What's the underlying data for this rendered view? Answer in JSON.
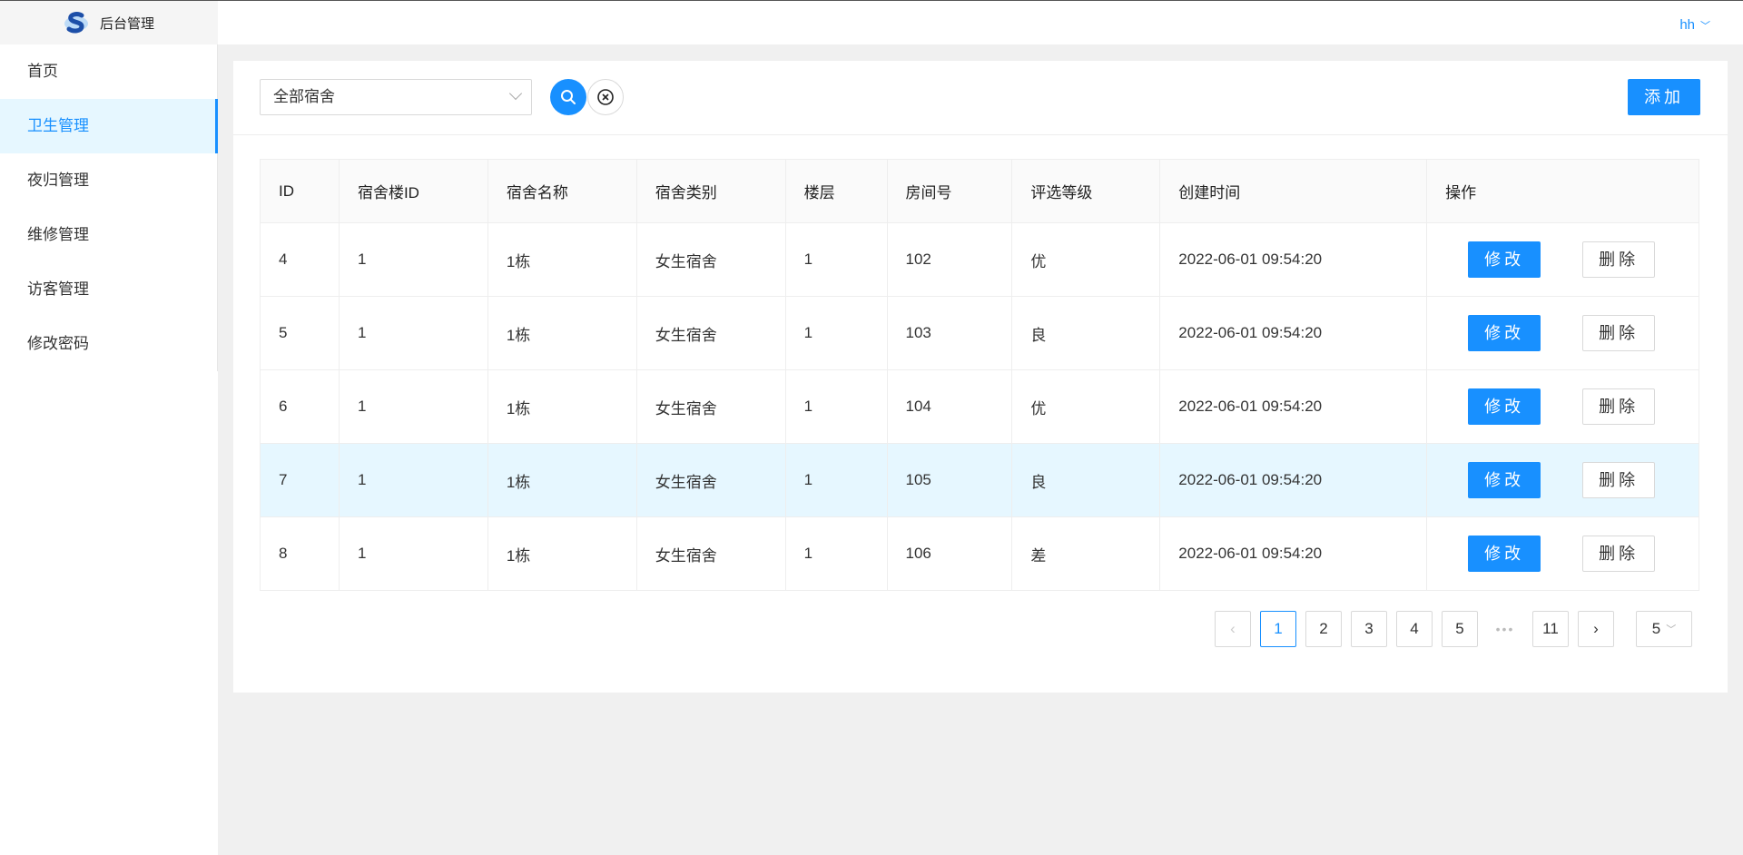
{
  "sidebar": {
    "logo_text": "后台管理",
    "items": [
      {
        "label": "首页"
      },
      {
        "label": "卫生管理"
      },
      {
        "label": "夜归管理"
      },
      {
        "label": "维修管理"
      },
      {
        "label": "访客管理"
      },
      {
        "label": "修改密码"
      }
    ],
    "active_index": 1
  },
  "header": {
    "user_name": "hh",
    "user_chevron": "﹀"
  },
  "toolbar": {
    "select_value": "全部宿舍",
    "add_label": "添加"
  },
  "table": {
    "columns": [
      "ID",
      "宿舍楼ID",
      "宿舍名称",
      "宿舍类别",
      "楼层",
      "房间号",
      "评选等级",
      "创建时间",
      "操作"
    ],
    "rows": [
      {
        "id": "4",
        "building_id": "1",
        "dorm_name": "1栋",
        "dorm_type": "女生宿舍",
        "floor": "1",
        "room": "102",
        "grade": "优",
        "created": "2022-06-01 09:54:20"
      },
      {
        "id": "5",
        "building_id": "1",
        "dorm_name": "1栋",
        "dorm_type": "女生宿舍",
        "floor": "1",
        "room": "103",
        "grade": "良",
        "created": "2022-06-01 09:54:20"
      },
      {
        "id": "6",
        "building_id": "1",
        "dorm_name": "1栋",
        "dorm_type": "女生宿舍",
        "floor": "1",
        "room": "104",
        "grade": "优",
        "created": "2022-06-01 09:54:20"
      },
      {
        "id": "7",
        "building_id": "1",
        "dorm_name": "1栋",
        "dorm_type": "女生宿舍",
        "floor": "1",
        "room": "105",
        "grade": "良",
        "created": "2022-06-01 09:54:20"
      },
      {
        "id": "8",
        "building_id": "1",
        "dorm_name": "1栋",
        "dorm_type": "女生宿舍",
        "floor": "1",
        "room": "106",
        "grade": "差",
        "created": "2022-06-01 09:54:20"
      }
    ],
    "edit_label": "修改",
    "delete_label": "删除",
    "hovered_row_index": 3
  },
  "pagination": {
    "prev": "‹",
    "next": "›",
    "pages": [
      "1",
      "2",
      "3",
      "4",
      "5"
    ],
    "ellipsis": "•••",
    "last_page": "11",
    "current": "1",
    "page_size": "5",
    "page_size_chevron": "﹀"
  },
  "colors": {
    "primary": "#1890ff",
    "active_bg": "#e6f7ff"
  },
  "icons": {
    "logo": "logo-s-icon",
    "search": "search-icon",
    "reset": "close-circle-icon"
  }
}
